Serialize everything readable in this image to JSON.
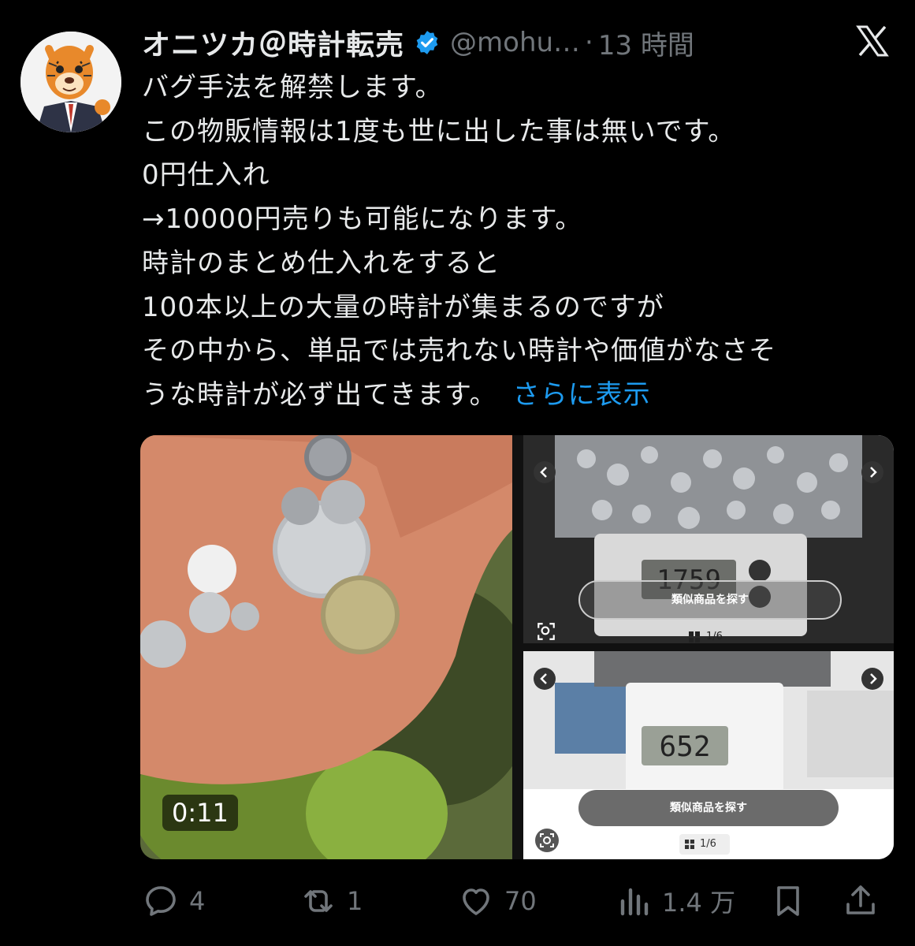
{
  "tweet": {
    "author_name": "オニツカ＠時計転売",
    "handle": "@mohu…",
    "separator": "·",
    "time": "13 時間",
    "lines": [
      "バグ手法を解禁します。",
      "この物販情報は1度も世に出した事は無いです。",
      "0円仕入れ",
      "→10000円売りも可能になります。",
      "時計のまとめ仕入れをすると",
      "100本以上の大量の時計が集まるのですが",
      "その中から、単品では売れない時計や価値がなさそ",
      "うな時計が必ず出てきます。"
    ],
    "show_more": "さらに表示"
  },
  "media": {
    "video_duration": "0:11",
    "top_right": {
      "scale_reading": "1759",
      "button": "類似商品を探す",
      "page": "1/6"
    },
    "bottom_right": {
      "scale_reading": "652",
      "button": "類似商品を探す",
      "page": "1/6"
    }
  },
  "actions": {
    "replies": "4",
    "reposts": "1",
    "likes": "70",
    "views": "1.4 万"
  },
  "colors": {
    "background": "#000000",
    "text": "#e7e9ea",
    "secondary": "#71767b",
    "link": "#1d9bf0",
    "verified": "#1d9bf0"
  }
}
